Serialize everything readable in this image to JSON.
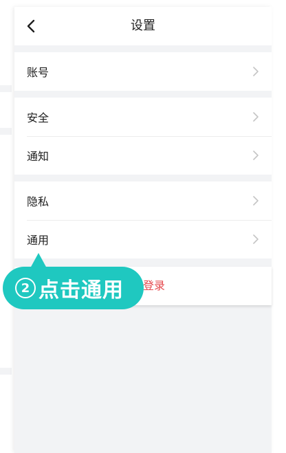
{
  "header": {
    "title": "设置",
    "back_icon": "chevron-left-icon"
  },
  "groups": [
    {
      "items": [
        {
          "label": "账号"
        }
      ]
    },
    {
      "items": [
        {
          "label": "安全"
        },
        {
          "label": "通知"
        }
      ]
    },
    {
      "items": [
        {
          "label": "隐私"
        },
        {
          "label": "通用"
        }
      ]
    }
  ],
  "logout": {
    "label": "退出登录",
    "color": "#e5484d"
  },
  "callout": {
    "step": "2",
    "text": "点击通用",
    "color": "#1fc8c0"
  },
  "colors": {
    "background": "#f2f3f5",
    "text": "#1f1f1f",
    "chevron": "#c5c5c5"
  }
}
